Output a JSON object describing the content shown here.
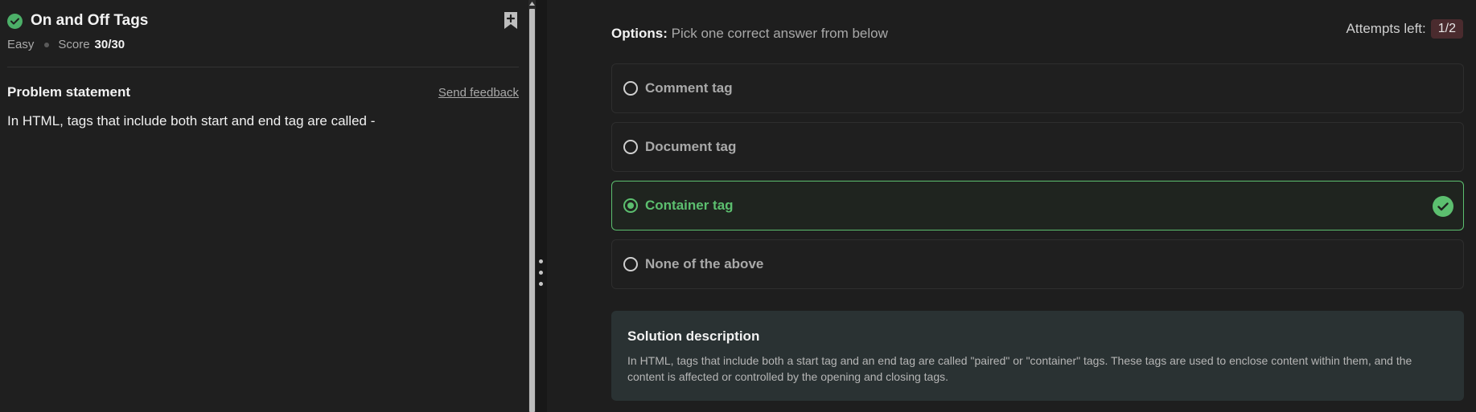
{
  "problem": {
    "title": "On and Off Tags",
    "difficulty": "Easy",
    "score_label": "Score",
    "score_value": "30/30",
    "statement_heading": "Problem statement",
    "feedback_link": "Send feedback",
    "statement_text": "In HTML, tags that include both start and end tag are called -"
  },
  "options_panel": {
    "label": "Options:",
    "instruction": "Pick one correct answer from below",
    "attempts_label": "Attempts left:",
    "attempts_value": "1/2",
    "options": [
      {
        "label": "Comment tag",
        "selected": false
      },
      {
        "label": "Document tag",
        "selected": false
      },
      {
        "label": "Container tag",
        "selected": true,
        "correct": true
      },
      {
        "label": "None of the above",
        "selected": false
      }
    ]
  },
  "solution": {
    "title": "Solution description",
    "text": "In HTML, tags that include both a start tag and an end tag are called \"paired\" or \"container\" tags. These tags are used to enclose content within them, and the content is affected or controlled by the opening and closing tags."
  },
  "colors": {
    "accent_green": "#5cbf6f",
    "background": "#1e1e1e",
    "attempts_badge": "#4a2b2e",
    "solution_bg": "#2a3233"
  },
  "icons": {
    "solved": "check-circle-icon",
    "bookmark": "bookmark-plus-icon",
    "correct": "check-circle-icon"
  }
}
